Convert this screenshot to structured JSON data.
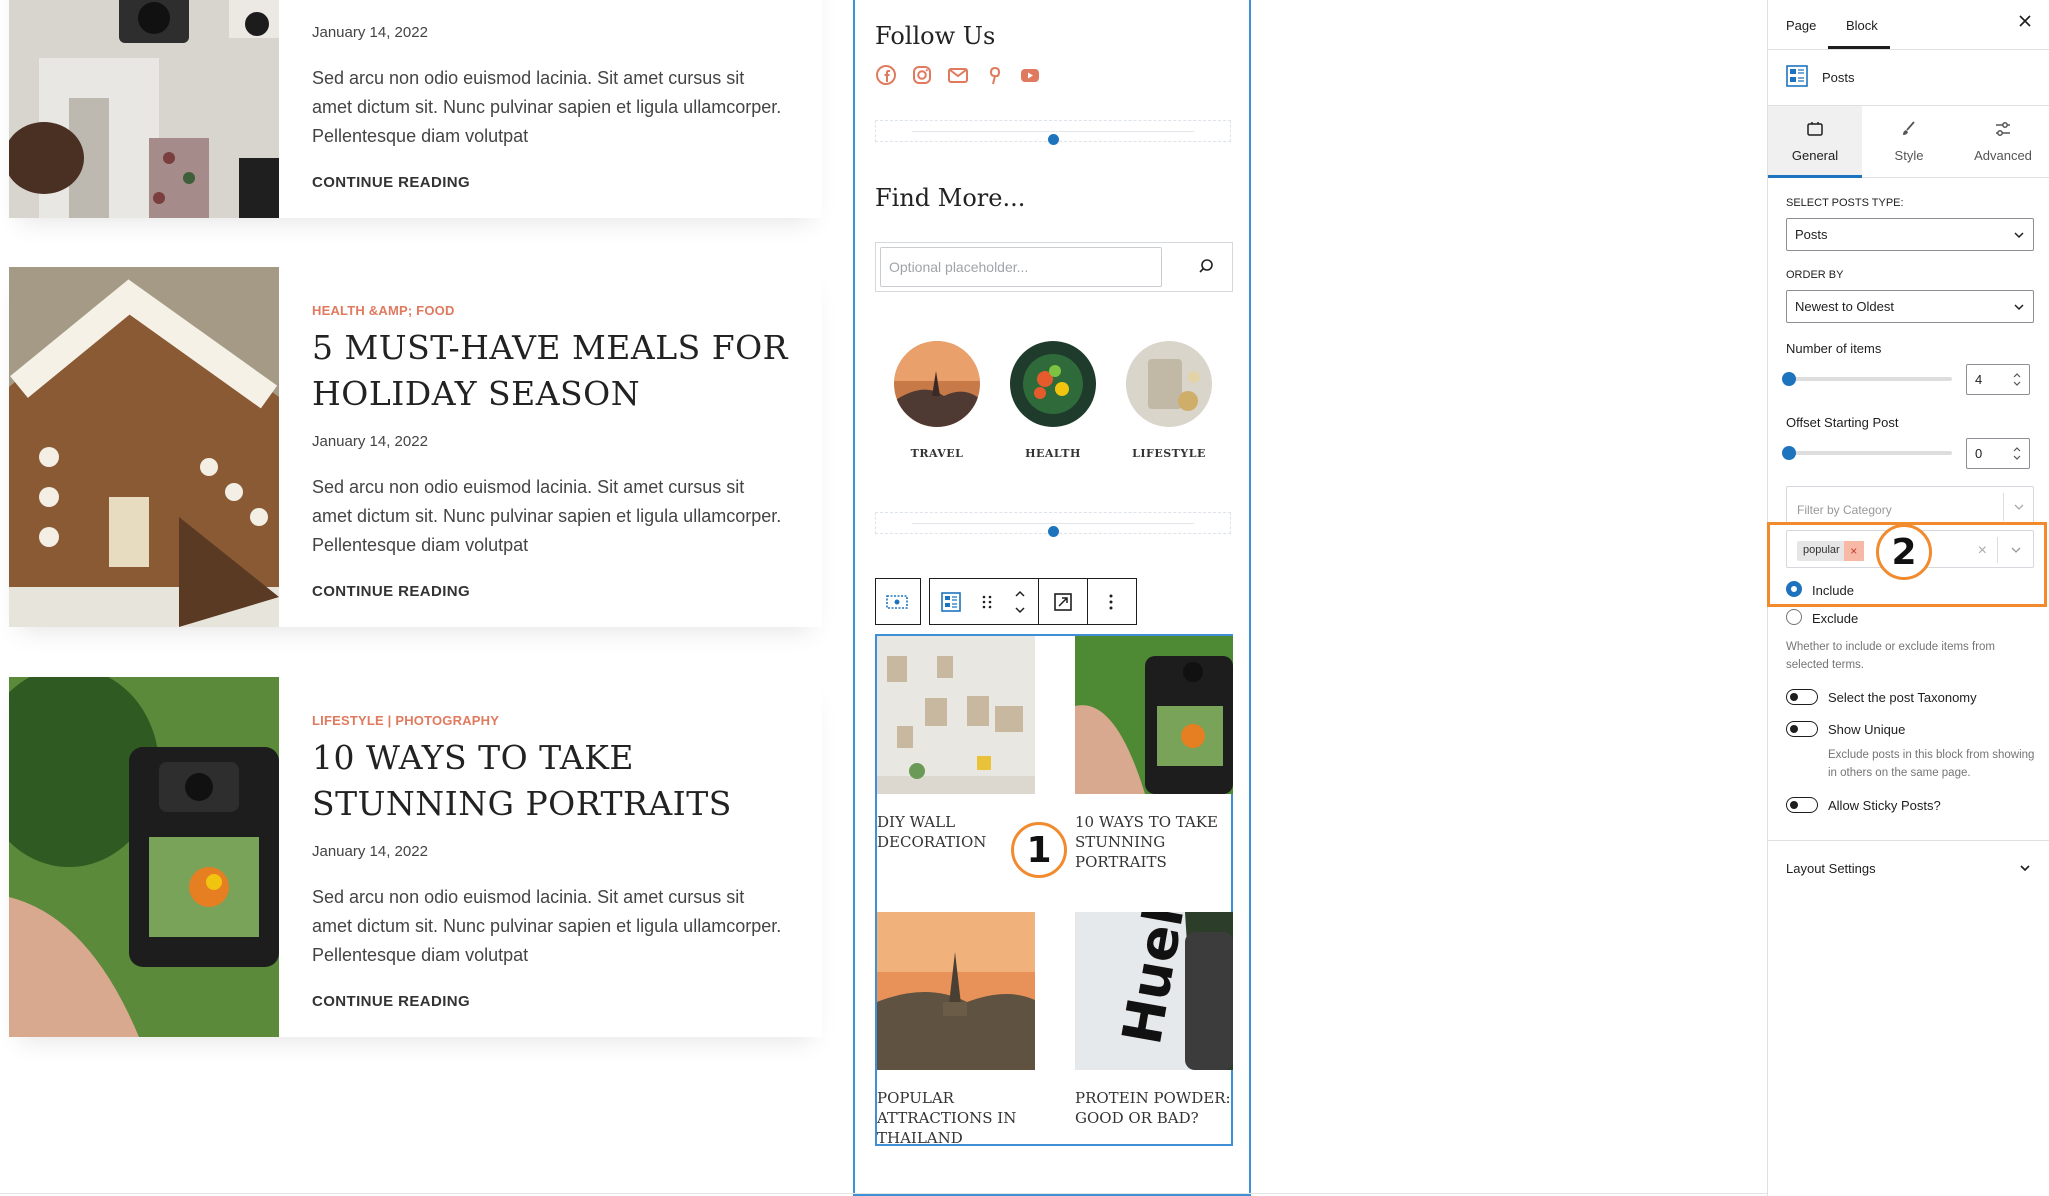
{
  "posts": [
    {
      "date": "January 14, 2022",
      "excerpt": "Sed arcu non odio euismod lacinia. Sit amet cursus sit amet dictum sit. Nunc pulvinar sapien et ligula ullamcorper. Pellentesque diam volutpat",
      "more": "CONTINUE READING"
    },
    {
      "category": "HEALTH &AMP; FOOD",
      "title": "5 MUST-HAVE MEALS FOR HOLIDAY SEASON",
      "date": "January 14, 2022",
      "excerpt": "Sed arcu non odio euismod lacinia. Sit amet cursus sit amet dictum sit. Nunc pulvinar sapien et ligula ullamcorper. Pellentesque diam volutpat",
      "more": "CONTINUE READING"
    },
    {
      "category": "LIFESTYLE | PHOTOGRAPHY",
      "title": "10 WAYS TO TAKE STUNNING PORTRAITS",
      "date": "January 14, 2022",
      "excerpt": "Sed arcu non odio euismod lacinia. Sit amet cursus sit amet dictum sit. Nunc pulvinar sapien et ligula ullamcorper. Pellentesque diam volutpat",
      "more": "CONTINUE READING"
    }
  ],
  "sidebar": {
    "follow_title": "Follow Us",
    "social_icons": [
      "facebook-icon",
      "instagram-icon",
      "mail-icon",
      "pinterest-icon",
      "youtube-icon"
    ],
    "find_title": "Find More...",
    "search_placeholder": "Optional placeholder...",
    "categories": [
      "TRAVEL",
      "HEALTH",
      "LIFESTYLE"
    ],
    "grid_posts": [
      "DIY WALL DECORATION",
      "10 WAYS TO TAKE STUNNING PORTRAITS",
      "POPULAR ATTRACTIONS IN THAILAND",
      "PROTEIN POWDER: GOOD OR BAD?"
    ],
    "accent_color": "#e07a5f"
  },
  "annotations": {
    "one": "1",
    "two": "2",
    "color": "#f28a2e"
  },
  "inspector": {
    "tabs": [
      "Page",
      "Block"
    ],
    "active_tab": "Block",
    "block_name": "Posts",
    "subtabs": [
      "General",
      "Style",
      "Advanced"
    ],
    "active_subtab": "General",
    "posts_type_label": "SELECT POSTS TYPE:",
    "posts_type_value": "Posts",
    "order_label": "ORDER BY",
    "order_value": "Newest to Oldest",
    "items_label": "Number of items",
    "items_value": "4",
    "offset_label": "Offset Starting Post",
    "offset_value": "0",
    "filter_placeholder": "Filter by Category",
    "filter_tag": "popular",
    "include_label": "Include",
    "exclude_label": "Exclude",
    "include_selected": true,
    "include_help": "Whether to include or exclude items from selected terms.",
    "taxonomy_label": "Select the post Taxonomy",
    "unique_label": "Show Unique",
    "unique_help": "Exclude posts in this block from showing in others on the same page.",
    "sticky_label": "Allow Sticky Posts?",
    "layout_label": "Layout Settings",
    "accent_color": "#1e73be"
  }
}
